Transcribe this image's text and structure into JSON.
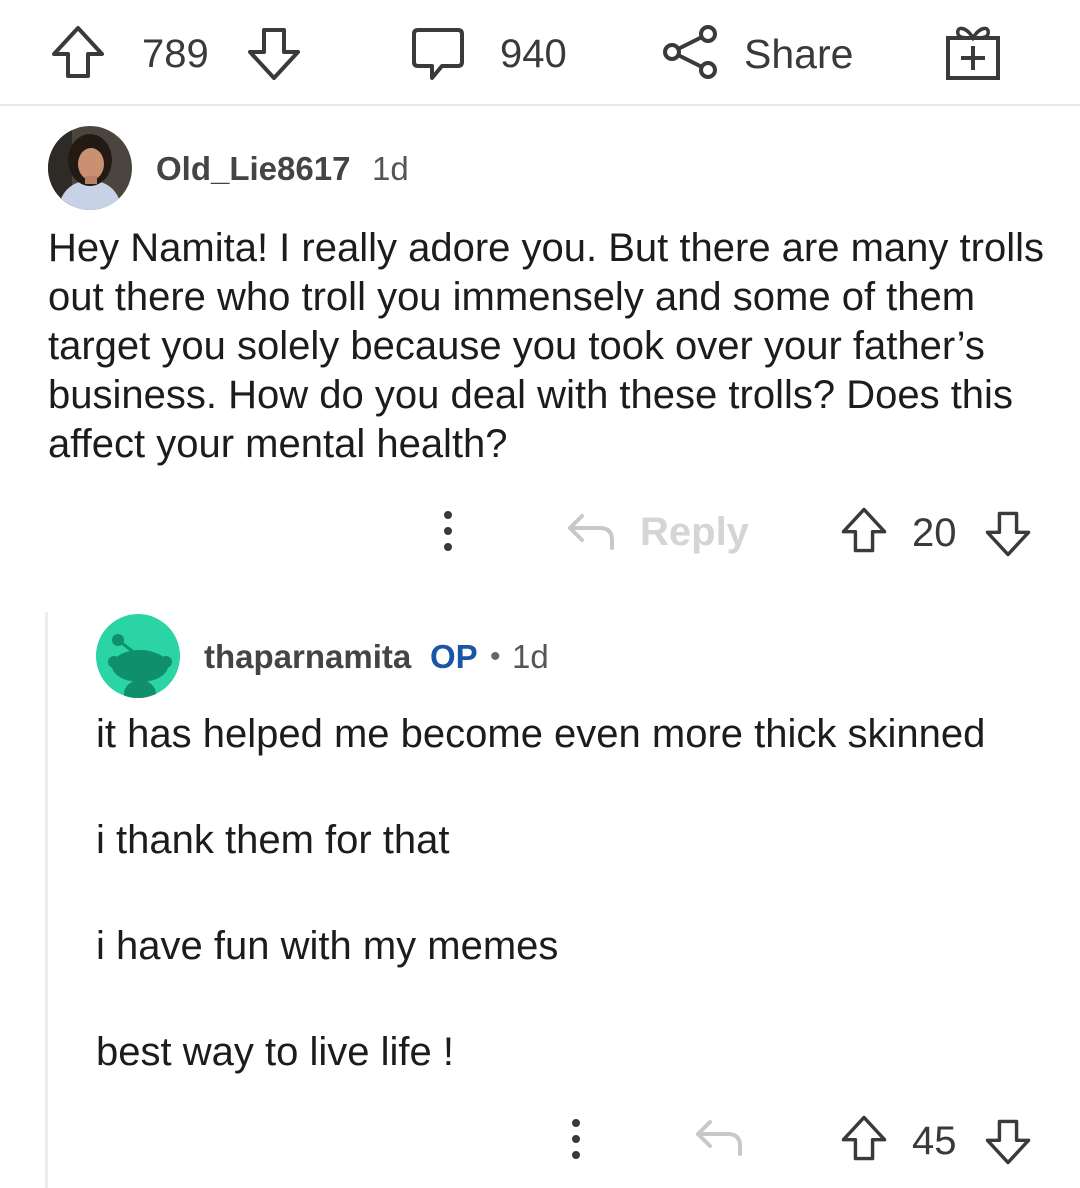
{
  "post_bar": {
    "upvotes": "789",
    "comments": "940",
    "share_label": "Share"
  },
  "comment1": {
    "username": "Old_Lie8617",
    "time": "1d",
    "body": "Hey Namita! I really adore you. But there are many trolls out there who troll you immensely and some of them target you solely because you took over your father’s business. How do you deal with these trolls? Does this affect your mental health?",
    "reply_label": "Reply",
    "votes": "20"
  },
  "comment2": {
    "username": "thaparnamita",
    "op_badge": "OP",
    "separator": "•",
    "time": "1d",
    "paragraphs": [
      "it has helped me become even more thick skinned",
      "i thank them for that",
      "i have fun with my memes",
      "best way to live life !"
    ],
    "votes": "45"
  },
  "colors": {
    "icon_gray": "#3a3a3a",
    "op_blue": "#1a56a8",
    "snoo_teal": "#2ad4a4",
    "reply_disabled": "#d5d5d5"
  }
}
